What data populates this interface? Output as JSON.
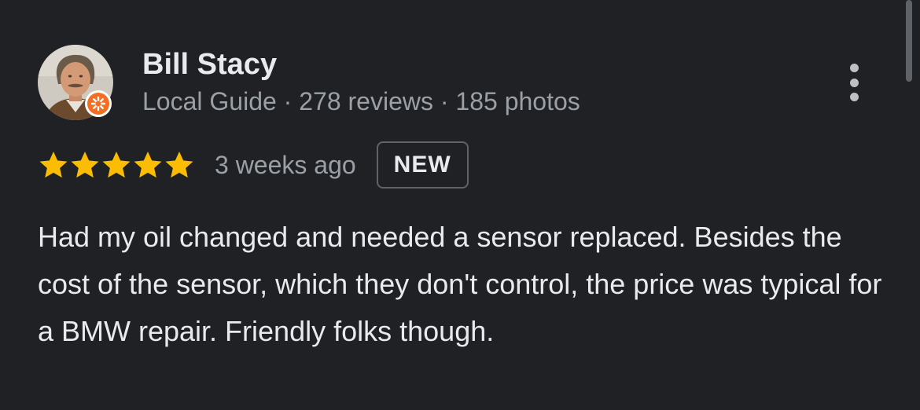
{
  "reviewer": {
    "name": "Bill Stacy",
    "meta": "Local Guide · 278 reviews · 185 photos",
    "avatar_icon": "person-avatar",
    "badge_icon": "local-guide-star-icon",
    "badge_color": "#f26e22"
  },
  "rating": {
    "stars": 5,
    "max_stars": 5,
    "star_color": "#fbbc04",
    "time": "3 weeks ago",
    "badge": "NEW"
  },
  "review": {
    "text": "Had my oil changed and needed a sensor replaced. Besides the cost of the sensor, which they don't control, the price was typical for a BMW repair. Friendly folks though."
  },
  "menu": {
    "icon": "more-vert-icon"
  }
}
